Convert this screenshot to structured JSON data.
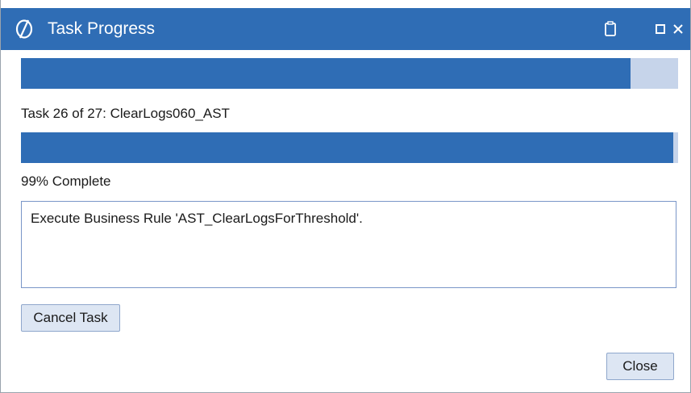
{
  "window": {
    "title": "Task Progress",
    "icons": {
      "app": "app-logo-icon",
      "restore": "clipboard-icon",
      "maximize": "maximize-icon",
      "close": "close-icon"
    },
    "colors": {
      "titlebar": "#2f6db5",
      "progress_fill": "#2f6db5",
      "progress_track": "#c6d4ea",
      "button_bg": "#dde6f3",
      "log_border": "#7a96c8"
    }
  },
  "overall_progress": {
    "fraction": 0.927
  },
  "task": {
    "label": "Task 26 of 27: ClearLogs060_AST",
    "fraction": 0.993
  },
  "percent_label": "99% Complete",
  "log": {
    "text": "Execute Business Rule 'AST_ClearLogsForThreshold'."
  },
  "buttons": {
    "cancel": "Cancel Task",
    "close": "Close"
  }
}
